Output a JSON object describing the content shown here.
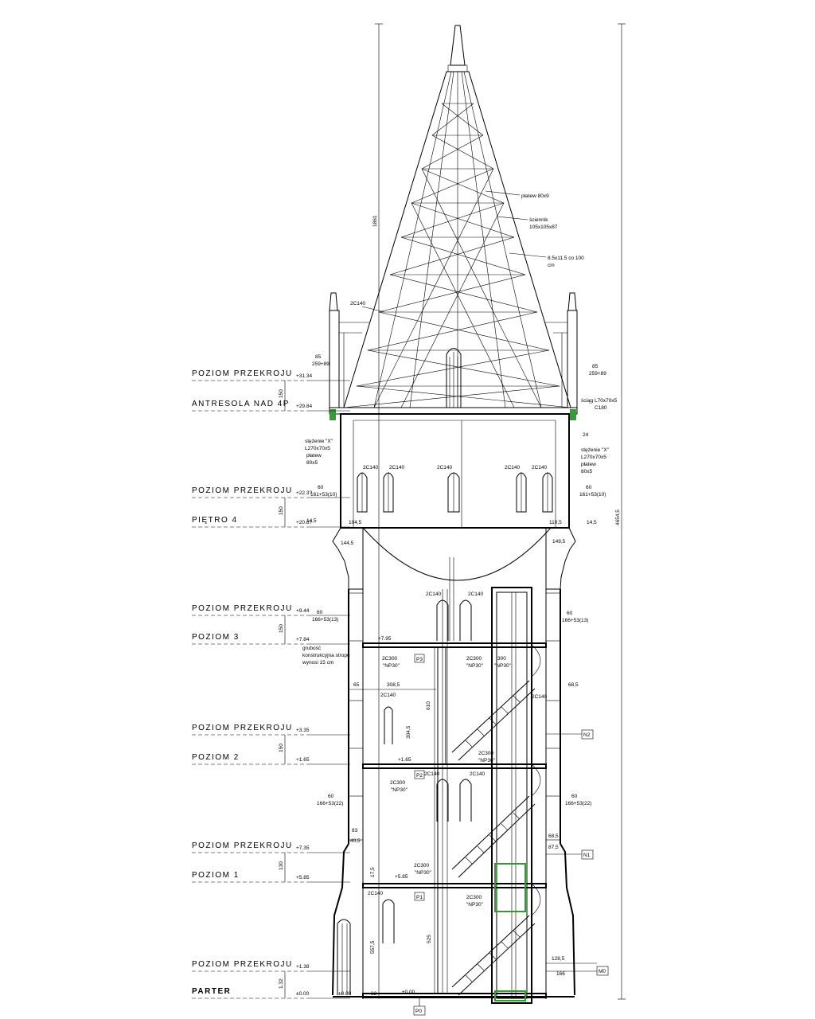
{
  "levels": [
    {
      "name": "POZIOM PRZEKROJU",
      "elev": "+31.34"
    },
    {
      "name": "ANTRESOLA NAD 4P",
      "elev": "+29.84"
    },
    {
      "name": "POZIOM PRZEKROJU",
      "elev": "+22.3?"
    },
    {
      "name": "PIĘTRO 4",
      "elev": "+20.8?"
    },
    {
      "name": "POZIOM PRZEKROJU",
      "elev": "+9.44"
    },
    {
      "name": "POZIOM 3",
      "elev": "+7.84"
    },
    {
      "name": "POZIOM PRZEKROJU",
      "elev": "+3.35"
    },
    {
      "name": "POZIOM 2",
      "elev": "+1.65"
    },
    {
      "name": "POZIOM PRZEKROJU",
      "elev": "+7.35"
    },
    {
      "name": "POZIOM 1",
      "elev": "+5.85"
    },
    {
      "name": "POZIOM PRZEKROJU",
      "elev": "+1.38"
    },
    {
      "name": "PARTER",
      "elev": "±0.00"
    }
  ],
  "spans": [
    "150",
    "150",
    "150",
    "150",
    "150",
    "130",
    "150",
    "1.32"
  ],
  "dimensions": {
    "total_height": "4654,5",
    "spire_height": "1861",
    "plus_0": "±0.00",
    "floor_3": "+7.95",
    "floor_2": "+1.65",
    "floor_1": "+5.85"
  },
  "annotations": {
    "spire_1": "płatew 80x9",
    "spire_2a": "ściennik",
    "spire_2b": "105x105x87",
    "spire_3a": "8.5x11.5 co 100",
    "spire_3b": "cm",
    "spire_left": "2C140",
    "eave_l_a": "85",
    "eave_l_b": "259+89",
    "eave_r_a": "85",
    "eave_r_b": "259+89",
    "angle_r_a": "ściąg L70x70x5",
    "angle_r_b": "C180",
    "stz_l_1": "stężenie \"X\"",
    "stz_l_2": "L270x70x5",
    "stz_l_3": "płatew",
    "stz_l_4": "80x5",
    "stz_r_1": "stężenie \"X\"",
    "stz_r_2": "L270x70x5",
    "stz_r_3": "płatew",
    "stz_r_4": "80x5",
    "dim_24": "24",
    "top_c1": "2C140",
    "top_c2": "2C140",
    "top_c3": "2C140",
    "top_c4": "2C140",
    "top_c5": "2C140",
    "w_l_60": "60",
    "w_l_formula": "161+53(10)",
    "w_r_60": "60",
    "w_r_formula": "161+53(10)",
    "d_1045": "104,5",
    "d_1105": "110,5",
    "d_145a": "14,5",
    "d_145b": "14,5",
    "d_1445": "144,5",
    "d_1495": "149,5",
    "mid_c1": "2C140",
    "mid_c2": "2C140",
    "w3_l_60": "60",
    "w3_l_formula": "166+53(13)",
    "w3_r_60": "60",
    "w3_r_formula": "166+53(13)",
    "grub_1": "grubość",
    "grub_2": "konstrukcyjna stropu",
    "grub_3": "wynosi 15 cm",
    "p3": "P3",
    "p2": "P2",
    "p1": "P1",
    "p0": "P0",
    "c300a_1": "2C300",
    "c300a_2": "\"NP30\"",
    "c300b_1": "2C300",
    "c300b_2": "\"NP30\"",
    "c300c": "300",
    "c300c_2": "\"NP30\"",
    "d_65": "65",
    "d_3085": "308,5",
    "d_610": "610",
    "d_3045": "304,5",
    "c140_a": "2C140",
    "c140_b": "2C140",
    "d_685": "68,5",
    "n2": "N2",
    "n1": "N1",
    "m0": "M0",
    "w2_l_60": "60",
    "w2_l_formula": "166+53(22)",
    "w2_r_60": "60",
    "w2_r_formula": "166+53(22)",
    "c300d_1": "2C300",
    "c300d_2": "\"NP30\"",
    "c300e_1": "2C300",
    "c300e_2": "\"NP30\"",
    "c140_c": "2C140",
    "c140_d": "2C140",
    "d_83": "83",
    "d_405": "40,5",
    "d_175": "17,5",
    "d_685b": "68,5",
    "d_875": "87,5",
    "c300f_1": "2C300",
    "c300f_2": "\"NP30\"",
    "c300g_1": "2C300",
    "c300g_2": "\"NP30\"",
    "c140_e": "2C140",
    "d_5575": "557,5",
    "d_525": "525",
    "d_1285": "128,5",
    "d_166": "166",
    "d_32": "32"
  }
}
